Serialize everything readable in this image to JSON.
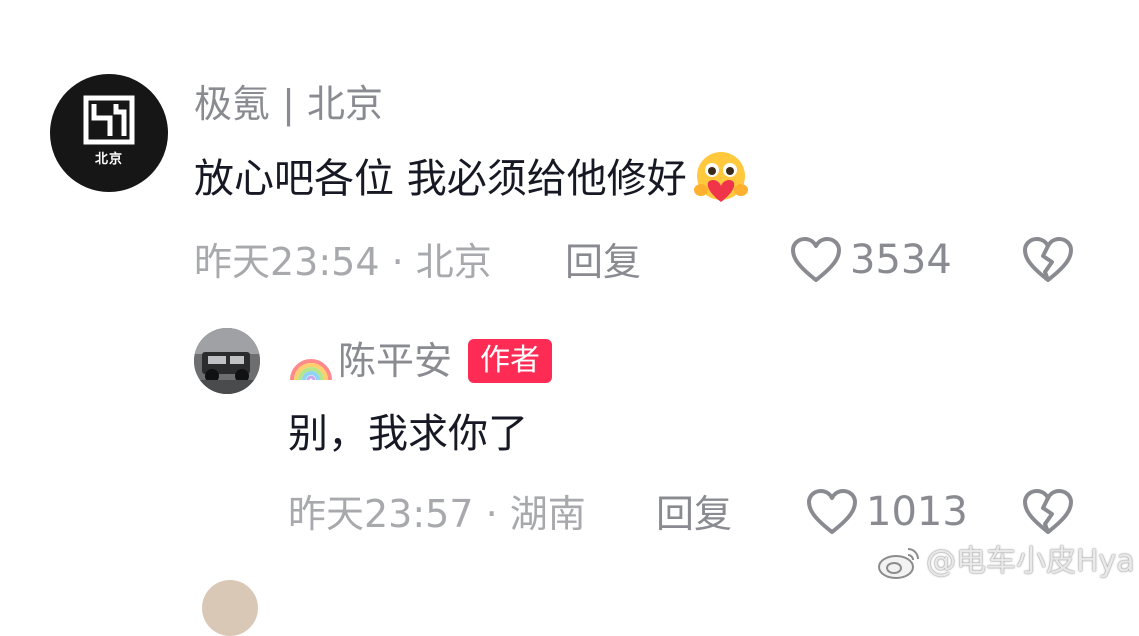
{
  "comments": [
    {
      "user": "极氪 | 北京",
      "avatar_label": "北京",
      "text": "放心吧各位 我必须给他修好",
      "emoji": "hug-heart-emoji",
      "time": "昨天23:54 · 北京",
      "reply_label": "回复",
      "likes": "3534"
    }
  ],
  "replies": [
    {
      "user": "陈平安",
      "badge": "作者",
      "text": "别，我求你了",
      "time": "昨天23:57 · 湖南",
      "reply_label": "回复",
      "likes": "1013"
    }
  ],
  "watermark": "@电车小皮Hya",
  "colors": {
    "accent": "#fe2c55",
    "muted_text": "#8a8b91",
    "meta_text": "#a8a9ad",
    "primary_text": "#161823"
  }
}
